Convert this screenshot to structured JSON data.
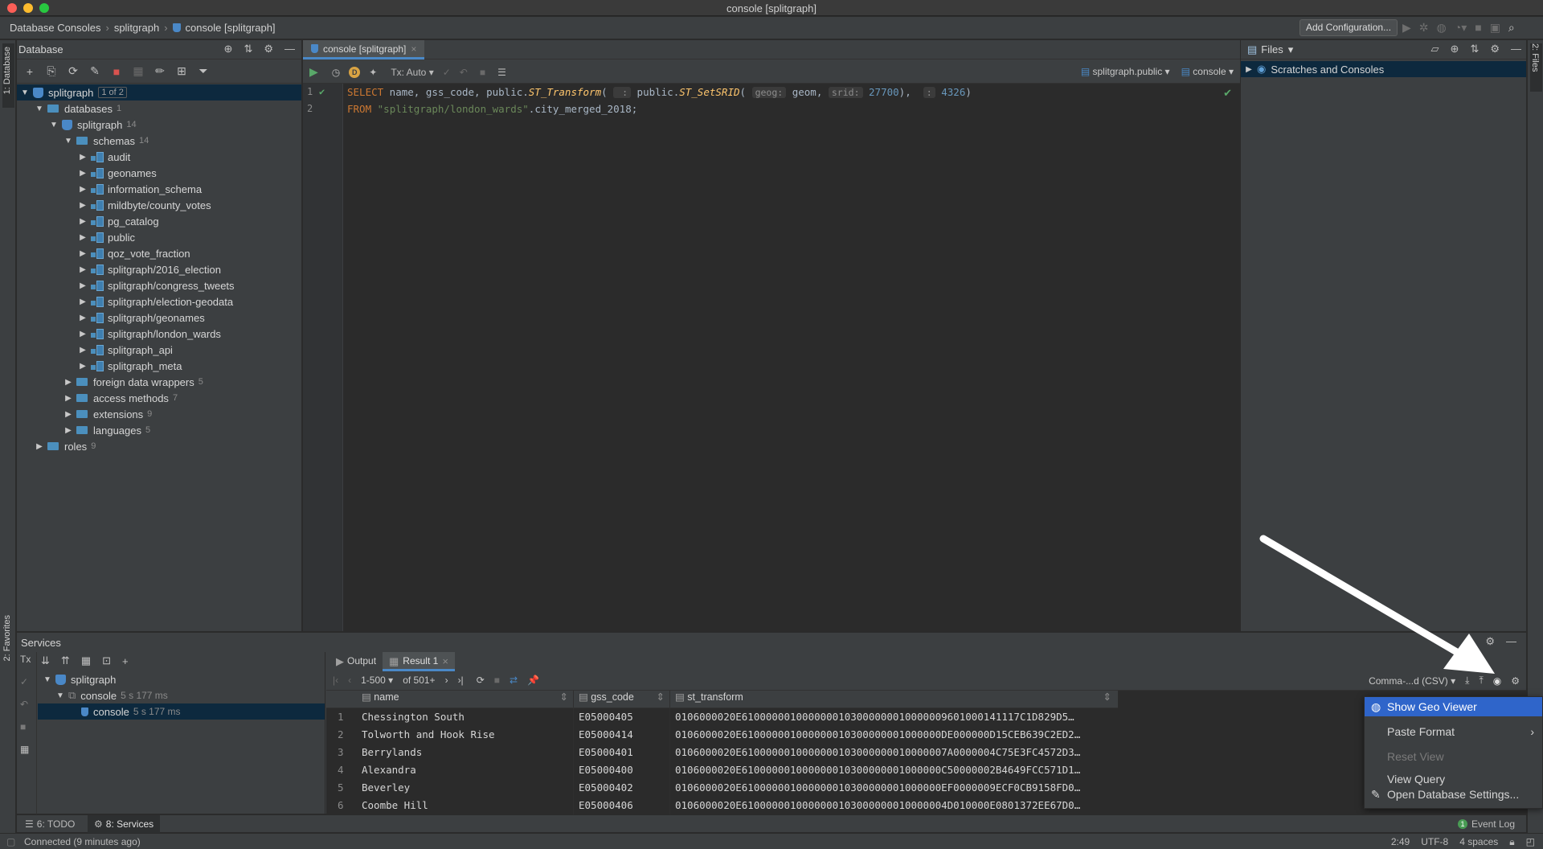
{
  "window": {
    "title": "console [splitgraph]"
  },
  "navbar": {
    "crumbs": [
      "Database Consoles",
      "splitgraph",
      "console [splitgraph]"
    ],
    "add_config": "Add Configuration..."
  },
  "left_strip": {
    "database": "1: Database",
    "favorites": "2: Favorites"
  },
  "right_strip": {
    "files": "2: Files"
  },
  "database_panel": {
    "title": "Database",
    "tree": [
      {
        "label": "splitgraph",
        "badge": "1 of 2",
        "depth": 0,
        "icon": "db-icon",
        "open": true,
        "selected": true
      },
      {
        "label": "databases",
        "count": "1",
        "depth": 1,
        "icon": "folder-icon",
        "open": true
      },
      {
        "label": "splitgraph",
        "count": "14",
        "depth": 2,
        "icon": "database-icon",
        "open": true
      },
      {
        "label": "schemas",
        "count": "14",
        "depth": 3,
        "icon": "folder-icon",
        "open": true
      },
      {
        "label": "audit",
        "depth": 4,
        "icon": "schema-icon"
      },
      {
        "label": "geonames",
        "depth": 4,
        "icon": "schema-icon"
      },
      {
        "label": "information_schema",
        "depth": 4,
        "icon": "schema-icon"
      },
      {
        "label": "mildbyte/county_votes",
        "depth": 4,
        "icon": "schema-icon"
      },
      {
        "label": "pg_catalog",
        "depth": 4,
        "icon": "schema-icon"
      },
      {
        "label": "public",
        "depth": 4,
        "icon": "schema-icon"
      },
      {
        "label": "qoz_vote_fraction",
        "depth": 4,
        "icon": "schema-icon"
      },
      {
        "label": "splitgraph/2016_election",
        "depth": 4,
        "icon": "schema-icon"
      },
      {
        "label": "splitgraph/congress_tweets",
        "depth": 4,
        "icon": "schema-icon"
      },
      {
        "label": "splitgraph/election-geodata",
        "depth": 4,
        "icon": "schema-icon"
      },
      {
        "label": "splitgraph/geonames",
        "depth": 4,
        "icon": "schema-icon"
      },
      {
        "label": "splitgraph/london_wards",
        "depth": 4,
        "icon": "schema-icon"
      },
      {
        "label": "splitgraph_api",
        "depth": 4,
        "icon": "schema-icon"
      },
      {
        "label": "splitgraph_meta",
        "depth": 4,
        "icon": "schema-icon"
      },
      {
        "label": "foreign data wrappers",
        "count": "5",
        "depth": 3,
        "icon": "folder-icon"
      },
      {
        "label": "access methods",
        "count": "7",
        "depth": 3,
        "icon": "folder-icon"
      },
      {
        "label": "extensions",
        "count": "9",
        "depth": 3,
        "icon": "folder-icon"
      },
      {
        "label": "languages",
        "count": "5",
        "depth": 3,
        "icon": "folder-icon"
      },
      {
        "label": "roles",
        "count": "9",
        "depth": 1,
        "icon": "folder-icon"
      }
    ]
  },
  "editor": {
    "tab": "console [splitgraph]",
    "tx": "Tx: Auto",
    "schema": "splitgraph.public",
    "session": "console",
    "line_numbers": [
      "1",
      "2"
    ],
    "line1": {
      "select": "SELECT",
      "cols": " name, gss_code, public.",
      "fn1": "ST_Transform",
      "paren1": "(",
      "hint_blank": " :",
      "public2": " public.",
      "fn2": "ST_SetSRID",
      "paren2": "(",
      "hint_geog": "geog:",
      "geom": " geom, ",
      "hint_srid": "srid:",
      "srid": "27700",
      "close1": "), ",
      "hint_colon": ":",
      "target": "4326",
      "close2": ")"
    },
    "line2": {
      "from": "FROM",
      "table": "\"splitgraph/london_wards\"",
      "rest": ".city_merged_2018;"
    }
  },
  "files_panel": {
    "title": "Files",
    "item": "Scratches and Consoles"
  },
  "services": {
    "title": "Services",
    "tree": [
      {
        "label": "splitgraph",
        "time": ""
      },
      {
        "label": "console",
        "time": "5 s 177 ms"
      },
      {
        "label": "console",
        "time": "5 s 177 ms"
      }
    ],
    "tabs": [
      "Output",
      "Result 1"
    ],
    "paging": {
      "range": "1-500",
      "of": "of 501+"
    },
    "export_format": "Comma-...d (CSV)",
    "columns": [
      "name",
      "gss_code",
      "st_transform"
    ],
    "rows": [
      [
        "1",
        "Chessington South",
        "E05000405",
        "0106000020E6100000010000000103000000010000009601000141117C1D829D5…"
      ],
      [
        "2",
        "Tolworth and Hook Rise",
        "E05000414",
        "0106000020E610000001000000010300000001000000DE000000D15CEB639C2ED2…"
      ],
      [
        "3",
        "Berrylands",
        "E05000401",
        "0106000020E6100000010000000103000000010000007A0000004C75E3FC4572D3…"
      ],
      [
        "4",
        "Alexandra",
        "E05000400",
        "0106000020E610000001000000010300000001000000C50000002B4649FCC571D1…"
      ],
      [
        "5",
        "Beverley",
        "E05000402",
        "0106000020E610000001000000010300000001000000EF0000009ECF0CB9158FD0…"
      ],
      [
        "6",
        "Coombe Hill",
        "E05000406",
        "0106000020E6100000010000000103000000010000004D010000E0801372EE67D0…"
      ]
    ]
  },
  "context_menu": {
    "items": [
      "Show Geo Viewer",
      "Paste Format",
      "Reset View",
      "View Query",
      "Open Database Settings..."
    ]
  },
  "toolwindows": {
    "todo": "6: TODO",
    "services": "8: Services",
    "event_log": "Event Log",
    "event_count": "1"
  },
  "statusbar": {
    "left": "Connected (9 minutes ago)",
    "pos": "2:49",
    "enc": "UTF-8",
    "indent": "4 spaces"
  },
  "colors": {
    "accent": "#4a88c7",
    "selection": "#2f65ca",
    "bg": "#2b2b2b",
    "panel": "#3c3f41"
  }
}
